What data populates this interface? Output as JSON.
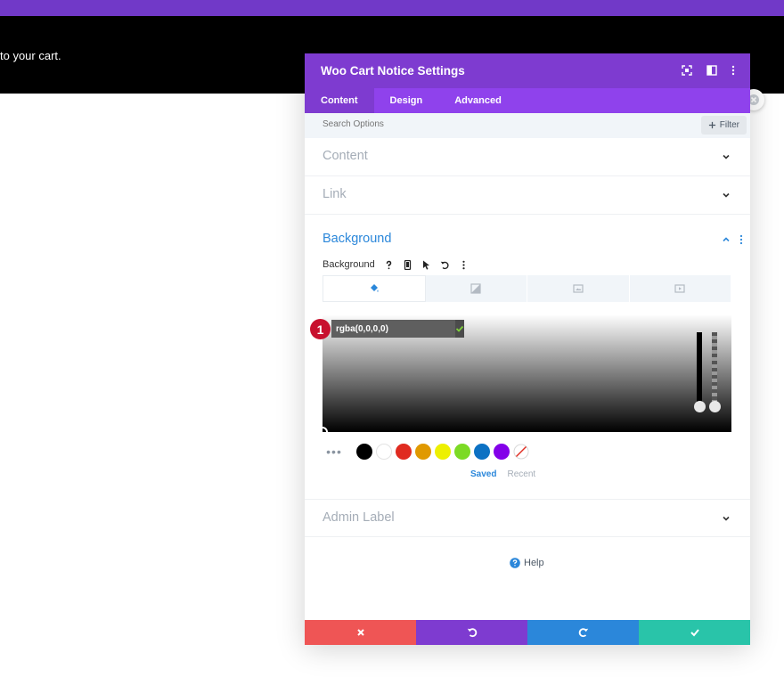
{
  "page": {
    "notice_text": "to your cart."
  },
  "modal": {
    "title": "Woo Cart Notice Settings",
    "tabs": [
      {
        "label": "Content",
        "active": true
      },
      {
        "label": "Design",
        "active": false
      },
      {
        "label": "Advanced",
        "active": false
      }
    ],
    "search_placeholder": "Search Options",
    "filter_label": "Filter",
    "sections": {
      "content": "Content",
      "link": "Link",
      "background": "Background",
      "admin_label": "Admin Label"
    },
    "background": {
      "option_label": "Background",
      "type_tabs": [
        "color-icon",
        "gradient-icon",
        "image-icon",
        "video-icon"
      ],
      "active_type": 0,
      "color_value": "rgba(0,0,0,0)",
      "step_badge": "1",
      "swatches": [
        "#000000",
        "#ffffff",
        "#e02b20",
        "#e09900",
        "#edf000",
        "#7cda24",
        "#0c71c3",
        "#8300e9"
      ],
      "palette_saved": "Saved",
      "palette_recent": "Recent"
    },
    "help_label": "Help",
    "footer_colors": {
      "cancel": "#ef5555",
      "undo": "#7e3bd0",
      "redo": "#2b87da",
      "save": "#29c4a9"
    }
  }
}
